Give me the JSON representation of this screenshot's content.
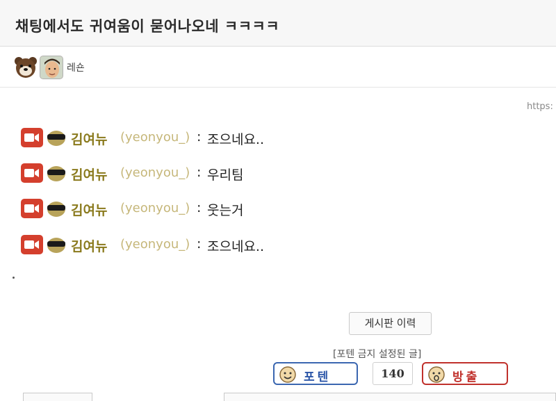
{
  "post": {
    "title": "채팅에서도 귀여움이 묻어나오네 ㅋㅋㅋㅋ",
    "author_name": "레숀",
    "url_fragment": "https:"
  },
  "chat": {
    "lines": [
      {
        "nickname": "김여뉴",
        "user_id": "(yeonyou_)",
        "colon": ":",
        "message": "조으네요.."
      },
      {
        "nickname": "김여뉴",
        "user_id": "(yeonyou_)",
        "colon": ":",
        "message": "우리팀"
      },
      {
        "nickname": "김여뉴",
        "user_id": "(yeonyou_)",
        "colon": ":",
        "message": "웃는거"
      },
      {
        "nickname": "김여뉴",
        "user_id": "(yeonyou_)",
        "colon": ":",
        "message": "조으네요.."
      }
    ]
  },
  "actions": {
    "history_label": "게시판 이력",
    "ban_note": "[포텐 금지 설정된 글]",
    "upvote_label": "포텐",
    "vote_count": "140",
    "downvote_label": "방출"
  },
  "colors": {
    "nickname": "#8a7a1d",
    "user_id": "#c6b77a",
    "camera_badge": "#d43f2d",
    "upvote": "#2c56a8",
    "downvote": "#c0302b"
  },
  "icons": {
    "avatar_1": "bear-avatar-icon",
    "avatar_2": "face-avatar-icon",
    "camera": "camera-icon",
    "sunglasses": "sunglasses-icon",
    "upvote": "smile-icon",
    "downvote": "sad-face-icon"
  }
}
